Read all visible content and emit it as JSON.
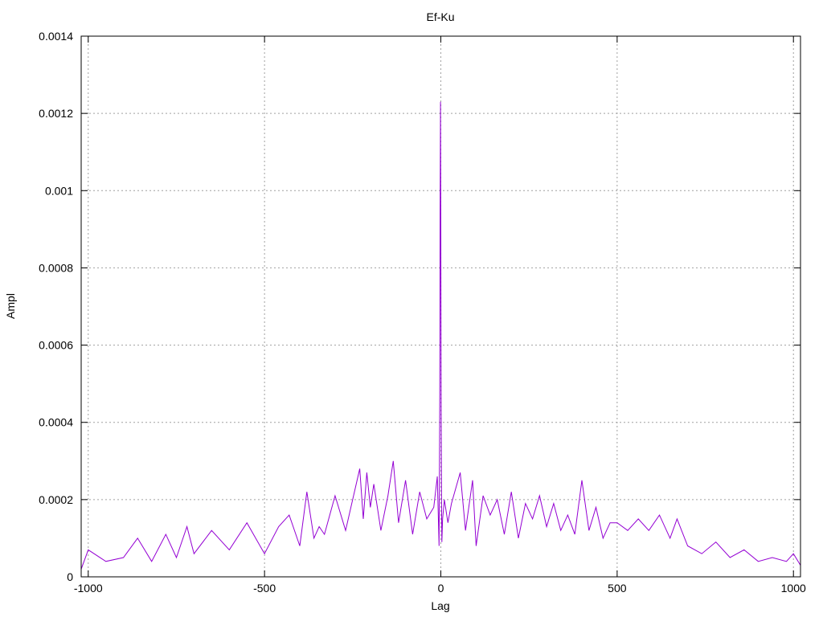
{
  "chart_data": {
    "type": "line",
    "title": "Ef-Ku",
    "xlabel": "Lag",
    "ylabel": "Ampl",
    "xlim": [
      -1020,
      1020
    ],
    "ylim": [
      0,
      0.0014
    ],
    "xticks": [
      -1000,
      -500,
      0,
      500,
      1000
    ],
    "xtick_labels": [
      "-1000",
      "-500",
      "0",
      "500",
      "1000"
    ],
    "yticks": [
      0,
      0.0002,
      0.0004,
      0.0006,
      0.0008,
      0.001,
      0.0012,
      0.0014
    ],
    "ytick_labels": [
      "0",
      "0.0002",
      "0.0004",
      "0.0006",
      "0.0008",
      "0.001",
      "0.0012",
      "0.0014"
    ],
    "grid": true,
    "line_color": "#9400d3",
    "series": [
      {
        "x": [
          -1020,
          -1000,
          -950,
          -900,
          -860,
          -820,
          -780,
          -750,
          -720,
          -700,
          -650,
          -600,
          -550,
          -500,
          -460,
          -430,
          -400,
          -380,
          -360,
          -345,
          -330,
          -300,
          -270,
          -240,
          -230,
          -220,
          -210,
          -200,
          -190,
          -170,
          -150,
          -135,
          -120,
          -100,
          -80,
          -60,
          -40,
          -20,
          -10,
          -5,
          -3,
          -2,
          -1,
          0,
          1,
          2,
          3,
          5,
          10,
          20,
          30,
          55,
          70,
          90,
          100,
          120,
          140,
          160,
          180,
          200,
          220,
          240,
          260,
          280,
          300,
          320,
          340,
          360,
          380,
          400,
          420,
          440,
          460,
          480,
          500,
          530,
          560,
          590,
          620,
          650,
          670,
          700,
          740,
          780,
          820,
          860,
          900,
          940,
          980,
          1000,
          1020
        ],
        "y": [
          2e-05,
          7e-05,
          4e-05,
          5e-05,
          0.0001,
          4e-05,
          0.00011,
          5e-05,
          0.00013,
          6e-05,
          0.00012,
          7e-05,
          0.00014,
          6e-05,
          0.00013,
          0.00016,
          8e-05,
          0.00022,
          0.0001,
          0.00013,
          0.00011,
          0.00021,
          0.00012,
          0.00024,
          0.00028,
          0.00015,
          0.00027,
          0.00018,
          0.00024,
          0.00012,
          0.00021,
          0.0003,
          0.00014,
          0.00025,
          0.00011,
          0.00022,
          0.00015,
          0.00018,
          0.00026,
          8e-05,
          0.00047,
          0.00094,
          0.00123,
          0.00091,
          0.00043,
          0.00017,
          9e-05,
          0.00015,
          0.0002,
          0.00014,
          0.00019,
          0.00027,
          0.00012,
          0.00025,
          8e-05,
          0.00021,
          0.00016,
          0.0002,
          0.00011,
          0.00022,
          0.0001,
          0.00019,
          0.00015,
          0.00021,
          0.00013,
          0.00019,
          0.00012,
          0.00016,
          0.00011,
          0.00025,
          0.00012,
          0.00018,
          0.0001,
          0.00014,
          0.00014,
          0.00012,
          0.00015,
          0.00012,
          0.00016,
          0.0001,
          0.00015,
          8e-05,
          6e-05,
          9e-05,
          5e-05,
          7e-05,
          4e-05,
          5e-05,
          4e-05,
          6e-05,
          3e-05
        ]
      }
    ]
  }
}
